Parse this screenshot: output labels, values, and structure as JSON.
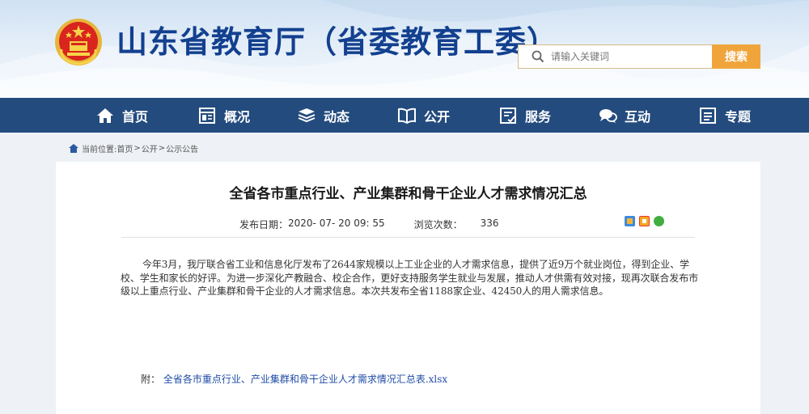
{
  "header": {
    "site_title": "山东省教育厅（省委教育工委）",
    "search_placeholder": "请输入关键词",
    "search_button": "搜索"
  },
  "nav": {
    "items": [
      {
        "label": "首页",
        "icon": "home-icon"
      },
      {
        "label": "概况",
        "icon": "overview-icon"
      },
      {
        "label": "动态",
        "icon": "news-stack-icon"
      },
      {
        "label": "公开",
        "icon": "open-book-icon"
      },
      {
        "label": "服务",
        "icon": "service-icon"
      },
      {
        "label": "互动",
        "icon": "chat-icon"
      },
      {
        "label": "专题",
        "icon": "topic-icon"
      }
    ]
  },
  "breadcrumb": {
    "prefix": "当前位置:",
    "items": [
      "首页",
      "公开",
      "公示公告"
    ],
    "separator": ">"
  },
  "article": {
    "title": "全省各市重点行业、产业集群和骨干企业人才需求情况汇总",
    "publish_label": "发布日期：",
    "publish_date": "2020- 07- 20 09: 55",
    "views_label": "浏览次数：",
    "views": "336",
    "body": "今年3月，我厅联合省工业和信息化厅发布了2644家规模以上工业企业的人才需求信息，提供了近9万个就业岗位，得到企业、学校、学生和家长的好评。为进一步深化产教融合、校企合作，更好支持服务学生就业与发展，推动人才供需有效对接，现再次联合发布市级以上重点行业、产业集群和骨干企业的人才需求信息。本次共发布全省1188家企业、42450人的用人需求信息。",
    "attachment_label": "附：",
    "attachment_link": "全省各市重点行业、产业集群和骨干企业人才需求情况汇总表.xlsx"
  },
  "colors": {
    "title_blue": "#13408f",
    "nav_bg": "#234b7e",
    "search_btn": "#f0a53c",
    "link": "#1f4ca6"
  }
}
